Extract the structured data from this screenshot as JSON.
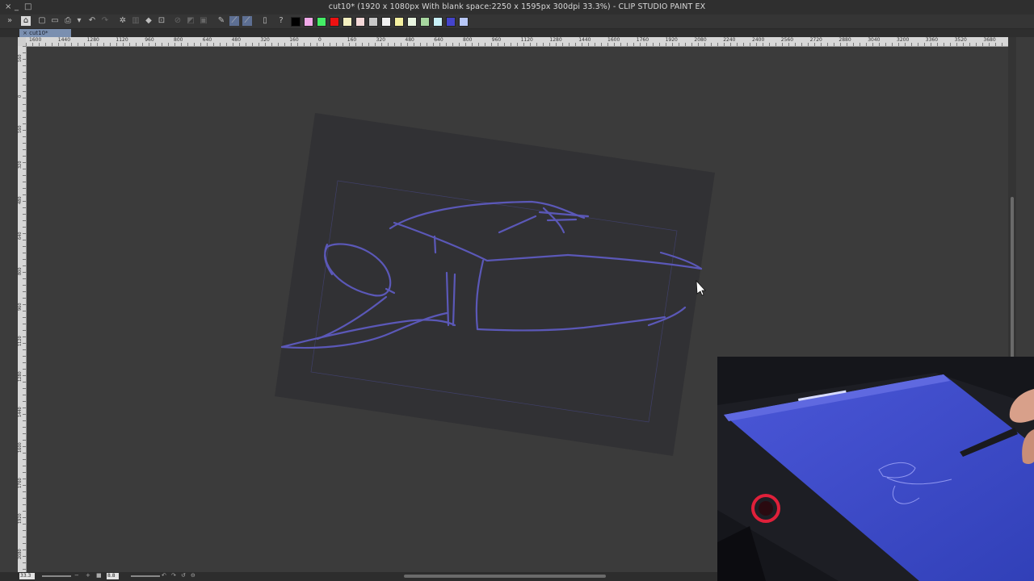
{
  "window": {
    "title": "cut10* (1920 x 1080px With blank space:2250 x 1595px 300dpi 33.3%) - CLIP STUDIO PAINT EX",
    "controls": [
      "×",
      "_",
      "□"
    ]
  },
  "tab": {
    "label": "cut10*"
  },
  "toolbar": {
    "swatches": [
      "#000000",
      "#f0a8e8",
      "#44ee66",
      "#ee1111",
      "#f4f0c0",
      "#f4d8d8",
      "#c8c8c8",
      "#f0f0f0",
      "#f4f0a0",
      "#e8f4e0",
      "#a8d8a0",
      "#c8f0f8",
      "#4444cc",
      "#b8c8f8"
    ]
  },
  "ruler": {
    "top_labels": [
      "1600",
      "1440",
      "1280",
      "1120",
      "960",
      "800",
      "640",
      "480",
      "320",
      "160",
      "0",
      "160",
      "320",
      "480",
      "640",
      "800",
      "960",
      "1120",
      "1280",
      "1440",
      "1600",
      "1760",
      "1920",
      "2080",
      "2240",
      "2400",
      "2560",
      "2720",
      "2880",
      "3040",
      "3200",
      "3360",
      "3520",
      "3680"
    ],
    "left_labels": [
      "160",
      "0",
      "160",
      "320",
      "480",
      "640",
      "800",
      "960",
      "1120",
      "1280",
      "1440",
      "1600",
      "1760",
      "1920",
      "2080"
    ]
  },
  "status": {
    "zoom": "33.3",
    "angle": "8.8"
  },
  "colors": {
    "workspace": "#3b3b3b",
    "canvas": "#313134",
    "stroke": "#5b58b8",
    "tab_active": "#7a8fb0"
  }
}
